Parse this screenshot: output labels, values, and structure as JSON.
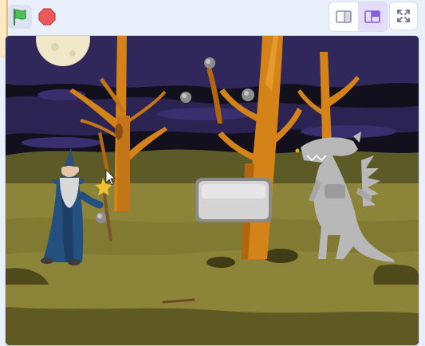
{
  "controls": {
    "green_flag": {
      "icon": "green-flag-icon",
      "color": "#4cbf56"
    },
    "stop": {
      "icon": "stop-sign-icon",
      "color": "#ec5959"
    }
  },
  "layout_modes": {
    "small_stage": {
      "icon": "small-stage-icon",
      "active": false
    },
    "normal_stage": {
      "icon": "normal-stage-icon",
      "active": true
    },
    "full_screen": {
      "icon": "full-screen-icon"
    }
  },
  "colors": {
    "accent": "#855cd6",
    "sky": "#30275a",
    "grass": "#8c8438",
    "tree": "#d48318"
  },
  "stage": {
    "sprites": [
      "wizard",
      "dragon",
      "rock-button",
      "boulders",
      "moon",
      "branch"
    ]
  }
}
